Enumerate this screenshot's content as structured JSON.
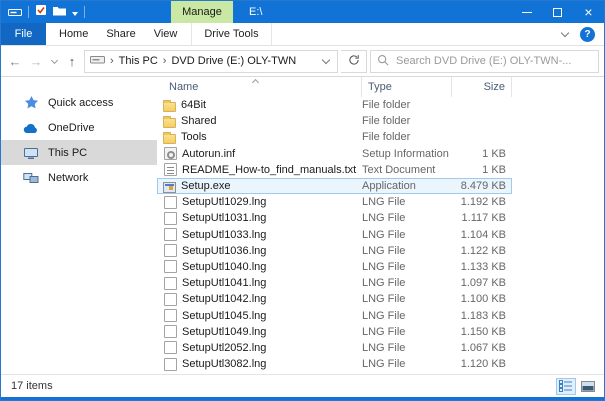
{
  "colors": {
    "accent": "#1273d7",
    "manage_tab_bg": "#c9e8a3",
    "selection_bg": "#eaf5fd",
    "selection_border": "#9fc9ef"
  },
  "icons": {
    "app": "dvd-drive-icon",
    "qat": [
      "checkmark-icon",
      "folder-icon",
      "chevron-down-icon"
    ],
    "window_controls": [
      "minimize-icon",
      "maximize-icon",
      "close-icon"
    ],
    "search": "magnifier-icon",
    "refresh": "refresh-icon",
    "help": "question-mark-icon"
  },
  "titlebar": {
    "manage_label": "Manage",
    "title": "E:\\"
  },
  "ribbon": {
    "tabs": [
      {
        "label": "File",
        "variant": "file"
      },
      {
        "label": "Home"
      },
      {
        "label": "Share"
      },
      {
        "label": "View"
      },
      {
        "label": "Drive Tools",
        "variant": "contextual"
      }
    ]
  },
  "toolbar": {
    "breadcrumb": [
      "This PC",
      "DVD Drive (E:) OLY-TWN"
    ],
    "search_placeholder": "Search DVD Drive (E:) OLY-TWN-..."
  },
  "sidebar": {
    "items": [
      {
        "label": "Quick access",
        "icon": "star-icon",
        "selected": false
      },
      {
        "label": "OneDrive",
        "icon": "cloud-icon",
        "selected": false
      },
      {
        "label": "This PC",
        "icon": "computer-icon",
        "selected": true
      },
      {
        "label": "Network",
        "icon": "network-icon",
        "selected": false
      }
    ]
  },
  "files": {
    "columns": [
      "Name",
      "Type",
      "Size"
    ],
    "sort": {
      "column": "Name",
      "direction": "ascending"
    },
    "rows": [
      {
        "name": "64Bit",
        "type": "File folder",
        "size": "",
        "icon": "folder-icon",
        "selected": false
      },
      {
        "name": "Shared",
        "type": "File folder",
        "size": "",
        "icon": "folder-icon",
        "selected": false
      },
      {
        "name": "Tools",
        "type": "File folder",
        "size": "",
        "icon": "folder-icon",
        "selected": false
      },
      {
        "name": "Autorun.inf",
        "type": "Setup Information",
        "size": "1 KB",
        "icon": "inf-icon",
        "selected": false
      },
      {
        "name": "README_How-to_find_manuals.txt",
        "type": "Text Document",
        "size": "1 KB",
        "icon": "txt-icon",
        "selected": false
      },
      {
        "name": "Setup.exe",
        "type": "Application",
        "size": "8.479 KB",
        "icon": "exe-icon",
        "selected": true
      },
      {
        "name": "SetupUtl1029.lng",
        "type": "LNG File",
        "size": "1.192 KB",
        "icon": "lng-icon",
        "selected": false
      },
      {
        "name": "SetupUtl1031.lng",
        "type": "LNG File",
        "size": "1.117 KB",
        "icon": "lng-icon",
        "selected": false
      },
      {
        "name": "SetupUtl1033.lng",
        "type": "LNG File",
        "size": "1.104 KB",
        "icon": "lng-icon",
        "selected": false
      },
      {
        "name": "SetupUtl1036.lng",
        "type": "LNG File",
        "size": "1.122 KB",
        "icon": "lng-icon",
        "selected": false
      },
      {
        "name": "SetupUtl1040.lng",
        "type": "LNG File",
        "size": "1.133 KB",
        "icon": "lng-icon",
        "selected": false
      },
      {
        "name": "SetupUtl1041.lng",
        "type": "LNG File",
        "size": "1.097 KB",
        "icon": "lng-icon",
        "selected": false
      },
      {
        "name": "SetupUtl1042.lng",
        "type": "LNG File",
        "size": "1.100 KB",
        "icon": "lng-icon",
        "selected": false
      },
      {
        "name": "SetupUtl1045.lng",
        "type": "LNG File",
        "size": "1.183 KB",
        "icon": "lng-icon",
        "selected": false
      },
      {
        "name": "SetupUtl1049.lng",
        "type": "LNG File",
        "size": "1.150 KB",
        "icon": "lng-icon",
        "selected": false
      },
      {
        "name": "SetupUtl2052.lng",
        "type": "LNG File",
        "size": "1.067 KB",
        "icon": "lng-icon",
        "selected": false
      },
      {
        "name": "SetupUtl3082.lng",
        "type": "LNG File",
        "size": "1.120 KB",
        "icon": "lng-icon",
        "selected": false
      }
    ]
  },
  "statusbar": {
    "items_count": "17 items",
    "views": [
      {
        "name": "details",
        "selected": true
      },
      {
        "name": "large-icons",
        "selected": false
      }
    ]
  }
}
